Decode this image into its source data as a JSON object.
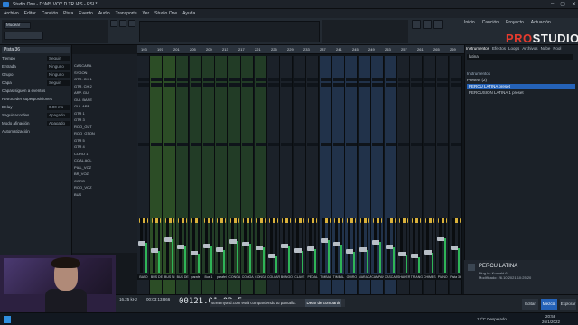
{
  "window": {
    "title": "Studio One - D:\\MS VOY D TR IAS - PSL*"
  },
  "menu": [
    "Archivo",
    "Editar",
    "Canción",
    "Pista",
    "Evento",
    "Audio",
    "Transporte",
    "Ver",
    "Studio One",
    "Ayuda"
  ],
  "toolbar": {
    "mode_label": "Mudear",
    "top_right_tabs": [
      "Inicio",
      "Canción",
      "Proyecto",
      "Actuación"
    ],
    "logo_pre": "PRO",
    "logo_post": "STUDIO"
  },
  "inspector": {
    "track_title": "Pista 36",
    "rows": [
      {
        "label": "Tiempo",
        "value": "Seguir"
      },
      {
        "label": "Entrada",
        "value": "Ninguno"
      },
      {
        "label": "Grupo",
        "value": "Ninguno"
      },
      {
        "label": "Capa",
        "value": "Seguir"
      },
      {
        "label": "Capas siguen a eventos",
        "value": ""
      },
      {
        "label": "Retroceder superposiciones",
        "value": ""
      },
      {
        "label": "Delay",
        "value": "0.00 ms"
      },
      {
        "label": "Seguir acordes",
        "value": "Apagado"
      },
      {
        "label": "Modo afinación",
        "value": "Apagado"
      },
      {
        "label": "Automatización",
        "value": ""
      }
    ]
  },
  "tracks": [
    "CASCARA",
    "SYGON",
    "GTR. CH 1",
    "GTR. CH 2",
    "ARP. GUI",
    "GUI. BASE",
    "GUI. ARP",
    "GTR 1",
    "GTR 3",
    "ROO_GUT",
    "ROO_GTON",
    "GTR 5",
    "GTR 4",
    "CORO 1",
    "COAL AGL",
    "PIAL_VOZ",
    "BR_VOZ",
    "CORO",
    "ROO_VOZ",
    "BUS"
  ],
  "ruler": [
    "193",
    "197",
    "201",
    "205",
    "209",
    "213",
    "217",
    "221",
    "225",
    "229",
    "233",
    "237",
    "241",
    "245",
    "249",
    "253",
    "257",
    "261",
    "265",
    "269"
  ],
  "channels": [
    {
      "name": "BAJO",
      "color": "dark",
      "level": 0.55
    },
    {
      "name": "BUS DE PI",
      "color": "lime",
      "level": 0.4
    },
    {
      "name": "BUS BI",
      "color": "lime",
      "level": 0.62
    },
    {
      "name": "BUS DE P",
      "color": "green",
      "level": 0.48
    },
    {
      "name": "parafe bombo",
      "color": "green",
      "level": 0.35
    },
    {
      "name": "Bus 1",
      "color": "green",
      "level": 0.5
    },
    {
      "name": "parafel congo",
      "color": "green",
      "level": 0.42
    },
    {
      "name": "CONGA 1",
      "color": "green",
      "level": 0.58
    },
    {
      "name": "CONGA 2",
      "color": "green",
      "level": 0.53
    },
    {
      "name": "CONGA 3",
      "color": "green",
      "level": 0.46
    },
    {
      "name": "COLLAR",
      "color": "dark",
      "level": 0.3
    },
    {
      "name": "BONGO",
      "color": "dark",
      "level": 0.5
    },
    {
      "name": "CLAVE",
      "color": "dark",
      "level": 0.4
    },
    {
      "name": "PEDAL",
      "color": "dark",
      "level": 0.44
    },
    {
      "name": "TIMBAL 1",
      "color": "blue",
      "level": 0.6
    },
    {
      "name": "TIMBAL 2",
      "color": "blue",
      "level": 0.52
    },
    {
      "name": "GUIRO",
      "color": "blue",
      "level": 0.38
    },
    {
      "name": "MARACA",
      "color": "blue",
      "level": 0.41
    },
    {
      "name": "CAMPANA",
      "color": "blue",
      "level": 0.56
    },
    {
      "name": "CASCARA",
      "color": "blue",
      "level": 0.47
    },
    {
      "name": "SHAKER",
      "color": "dark",
      "level": 0.33
    },
    {
      "name": "TRIANG",
      "color": "dark",
      "level": 0.29
    },
    {
      "name": "CHIMES",
      "color": "dark",
      "level": 0.36
    },
    {
      "name": "PIANO",
      "color": "dark",
      "level": 0.63
    },
    {
      "name": "Pista 36",
      "color": "dark",
      "level": 0.45
    }
  ],
  "browser": {
    "tabs": [
      "Instrumentos",
      "Efectos",
      "Loops",
      "Archivos",
      "Nube",
      "Pool"
    ],
    "section": "Instrumentos",
    "search_value": "latina",
    "presets_heading": "Presets (2)",
    "presets": [
      {
        "name": "PERCU LATINA preset",
        "selected": true
      },
      {
        "name": "PERCUSION LATINA 1 preset",
        "selected": false
      }
    ],
    "info_title": "PERCU LATINA",
    "info_lines": [
      "Plug-in: Kontakt 6",
      "Modificado: 26.10.2021 10:25:20"
    ]
  },
  "transport": {
    "time": "00121.01.02.5",
    "left_time": "00:03:13.866",
    "bpm_label": "16.25 kHz",
    "notification": "streamyard.com está compartiendo tu pantalla.",
    "notif_button": "Dejar de compartir"
  },
  "bottom_tabs": [
    "Editar",
    "Mezcla",
    "Explorar"
  ],
  "taskbar": {
    "weather": "12°C Despejado",
    "clock": "20:58",
    "date": "26/1/2022"
  }
}
